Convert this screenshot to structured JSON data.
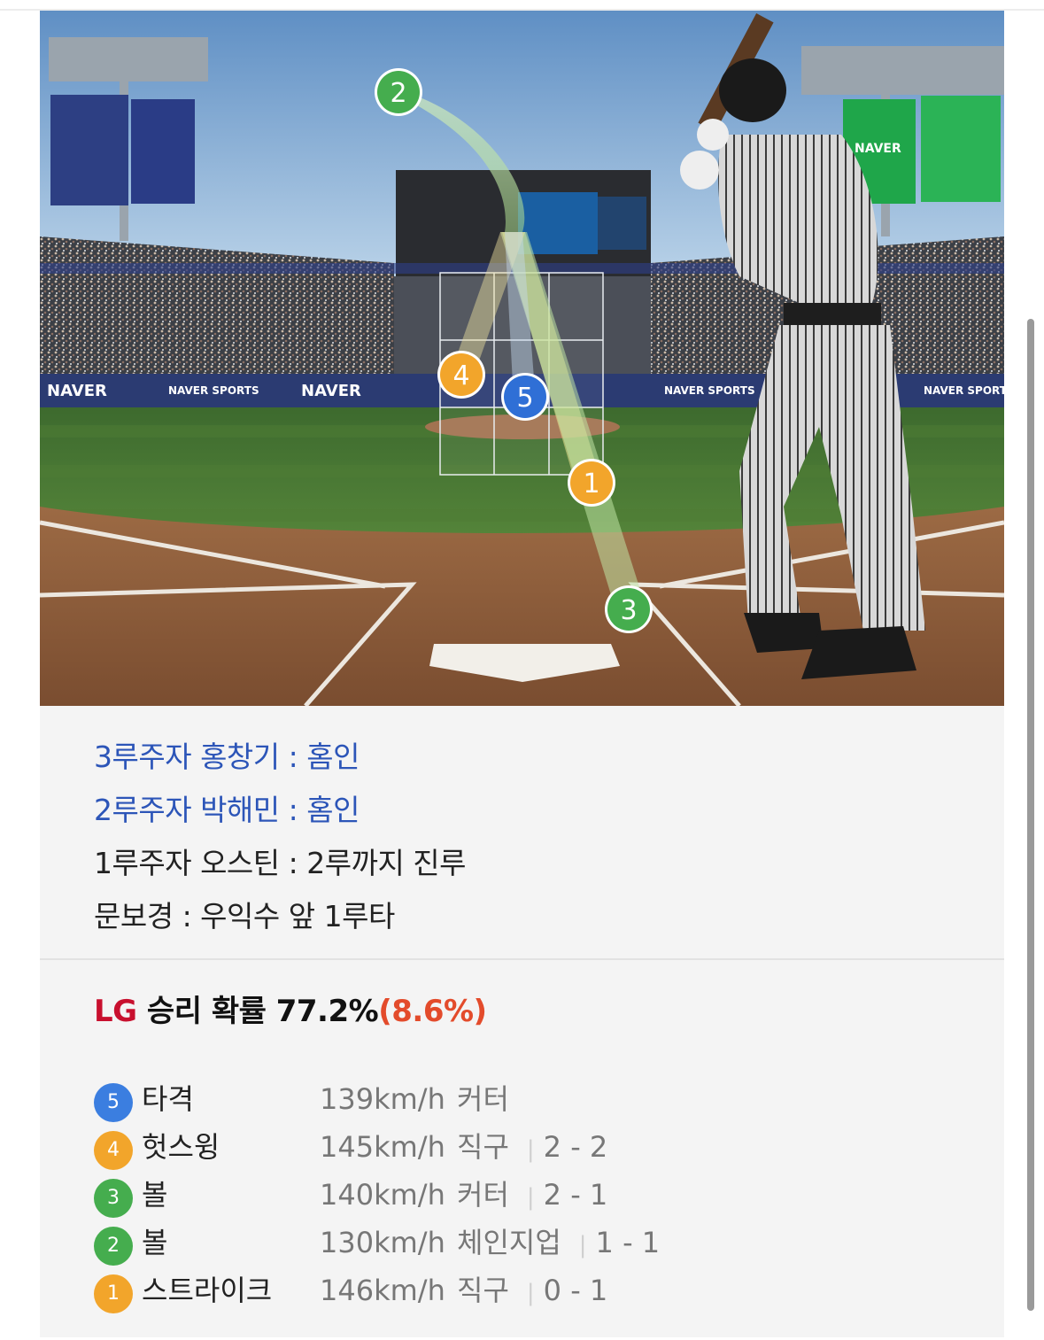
{
  "brand": {
    "naver": "NAVER",
    "naver_sports": "NAVER SPORTS",
    "sports": "SPORTS"
  },
  "markers": [
    {
      "num": "1",
      "color": "#f2a52b"
    },
    {
      "num": "2",
      "color": "#45ad4e"
    },
    {
      "num": "3",
      "color": "#45ad4e"
    },
    {
      "num": "4",
      "color": "#f2a52b"
    },
    {
      "num": "5",
      "color": "#2f6fd6"
    }
  ],
  "runners": [
    {
      "text": "3루주자 홍창기 : 홈인",
      "scored": true
    },
    {
      "text": "2루주자 박해민 : 홈인",
      "scored": true
    },
    {
      "text": "1루주자 오스틴 : 2루까지 진루",
      "scored": false
    },
    {
      "text": "문보경 : 우익수 앞 1루타",
      "scored": false
    }
  ],
  "win_prob": {
    "team": "LG",
    "label": "승리 확률",
    "value": "77.2%",
    "delta": "(8.6%)"
  },
  "pitches": [
    {
      "num": "5",
      "color": "#3b7ee0",
      "result": "타격",
      "speed": "139km/h",
      "type": "커터",
      "count": ""
    },
    {
      "num": "4",
      "color": "#f2a52b",
      "result": "헛스윙",
      "speed": "145km/h",
      "type": "직구",
      "count": "2 - 2"
    },
    {
      "num": "3",
      "color": "#45ad4e",
      "result": "볼",
      "speed": "140km/h",
      "type": "커터",
      "count": "2 - 1"
    },
    {
      "num": "2",
      "color": "#45ad4e",
      "result": "볼",
      "speed": "130km/h",
      "type": "체인지업",
      "count": "1 - 1"
    },
    {
      "num": "1",
      "color": "#f2a52b",
      "result": "스트라이크",
      "speed": "146km/h",
      "type": "직구",
      "count": "0 - 1"
    }
  ],
  "colors": {
    "score_text": "#2c55b8",
    "team": "#c8102e",
    "delta": "#e34b2b"
  }
}
